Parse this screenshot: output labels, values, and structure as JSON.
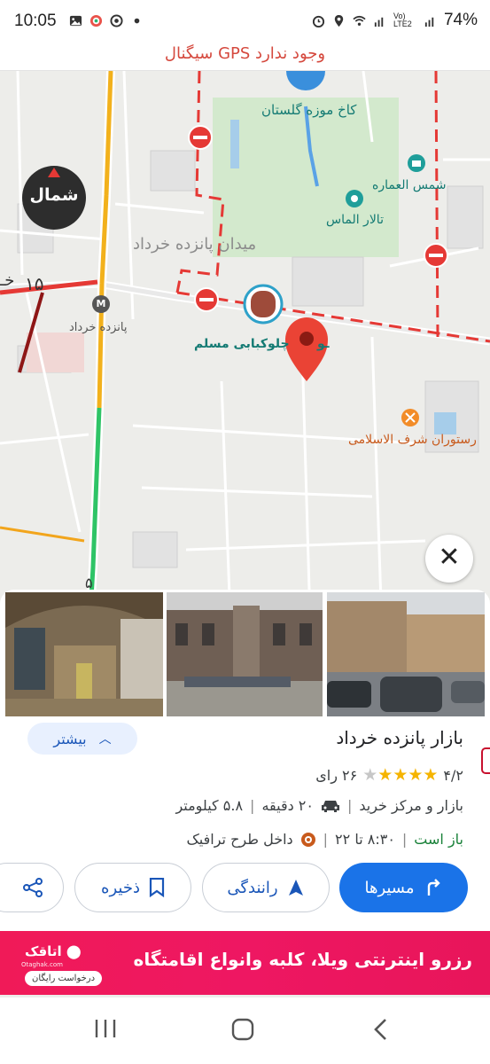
{
  "status_bar": {
    "time": "10:05",
    "battery": "74%",
    "network": "Vo) LTE2",
    "icons": [
      "image-icon",
      "target-icon",
      "circle-icon",
      "dot-icon",
      "alarm-icon",
      "location-icon",
      "wifi-icon",
      "signal-icon",
      "signal-icon"
    ]
  },
  "gps_banner": {
    "text": "سیگنال GPS وجود ندارد"
  },
  "map": {
    "compass_label": "شمال",
    "labels": {
      "golestan": "کاخ موزه گلستان",
      "shams": "شمس العماره",
      "almas": "تالار الماس",
      "square": "میدان پانزده خرداد",
      "metro": "پانزده خرداد",
      "moslem": "چلوکبابی مسلم",
      "moslem_partial": "ـو",
      "restaurant": "رستوران شرف الاسلامی",
      "street_number": "۱۵",
      "street_suffix": "خـ",
      "bottom_number": "۵"
    },
    "metro_letter": "M",
    "close_icon": "close-icon"
  },
  "place": {
    "name": "بازار پانزده خرداد",
    "more_label": "بیشتر",
    "rating": "۴/۲",
    "stars": 4.2,
    "reviews": "۲۶ رای",
    "category": "بازار و مرکز خرید",
    "drive_time": "۲۰ دقیقه",
    "distance": "۵.۸ کیلومتر",
    "open_status": "باز است",
    "hours": "۸:۳۰ تا ۲۲",
    "traffic": "داخل طرح ترافیک",
    "photos": [
      "bazaar-interior-photo",
      "bazaar-building-photo",
      "bazaar-street-photo"
    ]
  },
  "actions": {
    "routes": "مسیرها",
    "drive": "رانندگی",
    "save": "ذخیره"
  },
  "ad": {
    "text": "رزرو اینترنتی ویلا، کلبه وانواع اقامتگاه",
    "brand": "اتاقک",
    "domain": "Otaghak.com",
    "cta": "درخواست رایگان"
  },
  "colors": {
    "primary": "#1a73e8",
    "open": "#188038",
    "ad_bg": "#ee1762",
    "gps_warning": "#d5493e",
    "star": "#f5b400"
  }
}
